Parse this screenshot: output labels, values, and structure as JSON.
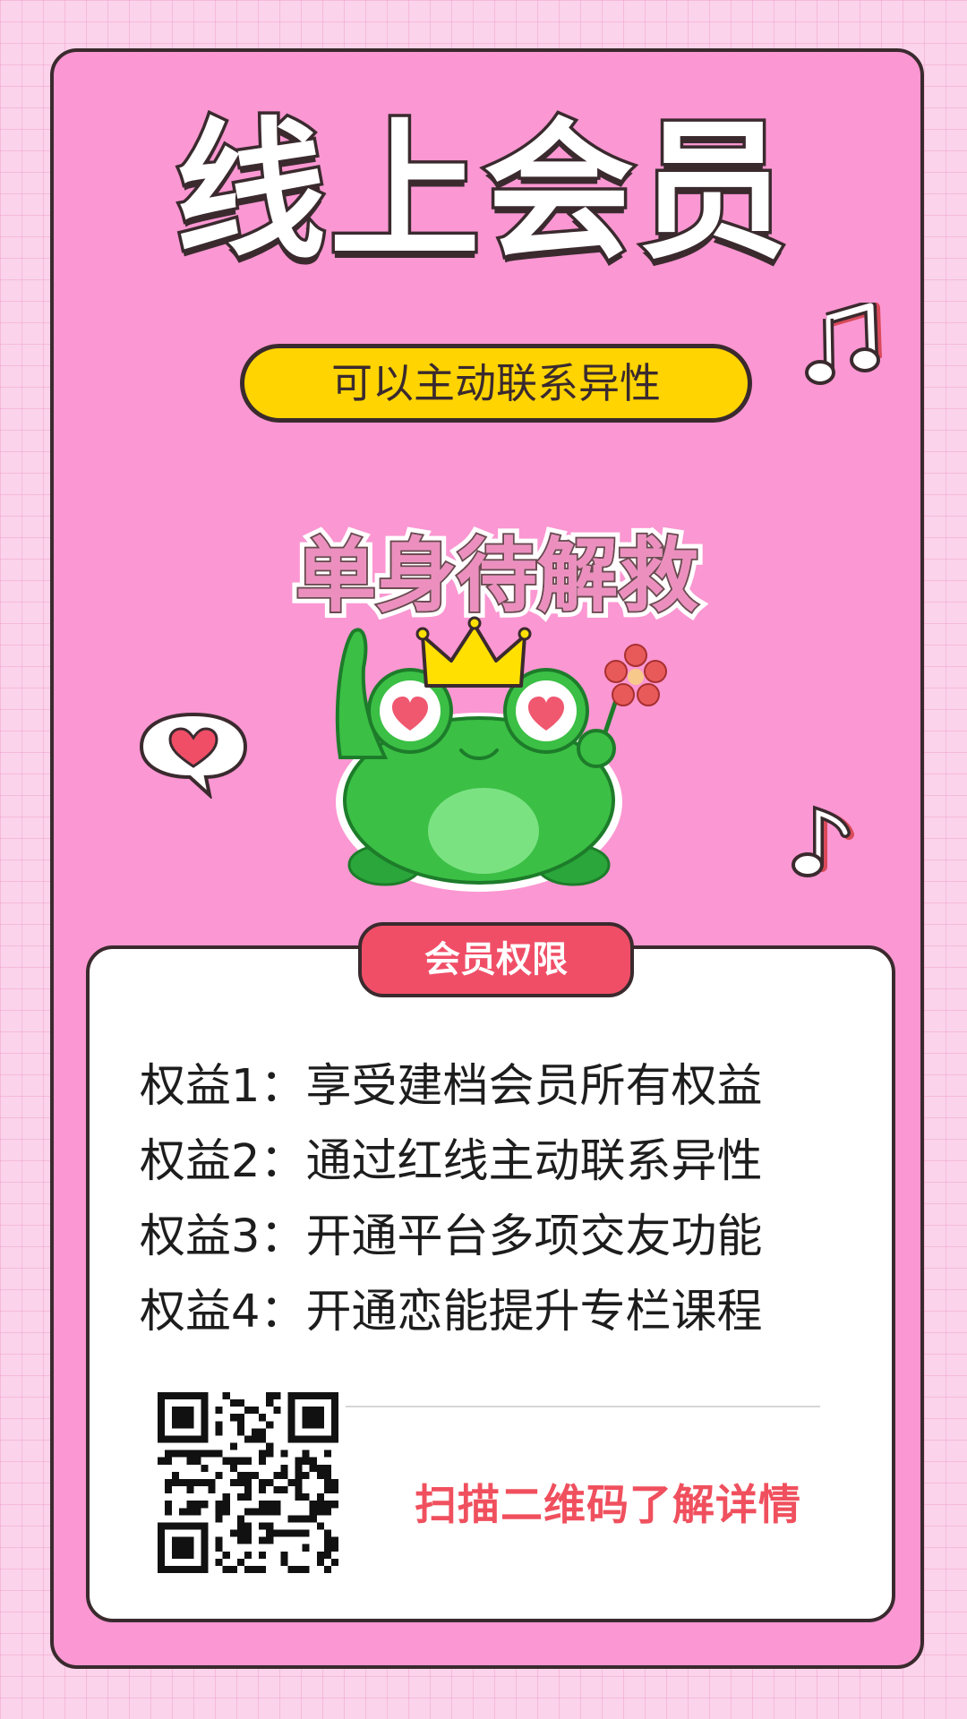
{
  "poster": {
    "title": "线上会员",
    "pill_text": "可以主动联系异性",
    "slogan": "单身待解救"
  },
  "card": {
    "tag": "会员权限",
    "benefits": [
      "权益1：享受建档会员所有权益",
      "权益2：通过红线主动联系异性",
      "权益3：开通平台多项交友功能",
      "权益4：开通恋能提升专栏课程"
    ],
    "scan_text": "扫描二维码了解详情"
  },
  "colors": {
    "poster_bg": "#fb97d2",
    "pill": "#ffd400",
    "tag": "#f04e67",
    "scan_text": "#f0505e"
  },
  "icons": [
    "music-note-icon",
    "frog-prince-illustration",
    "heart-speech-bubble-icon",
    "qr-code"
  ]
}
